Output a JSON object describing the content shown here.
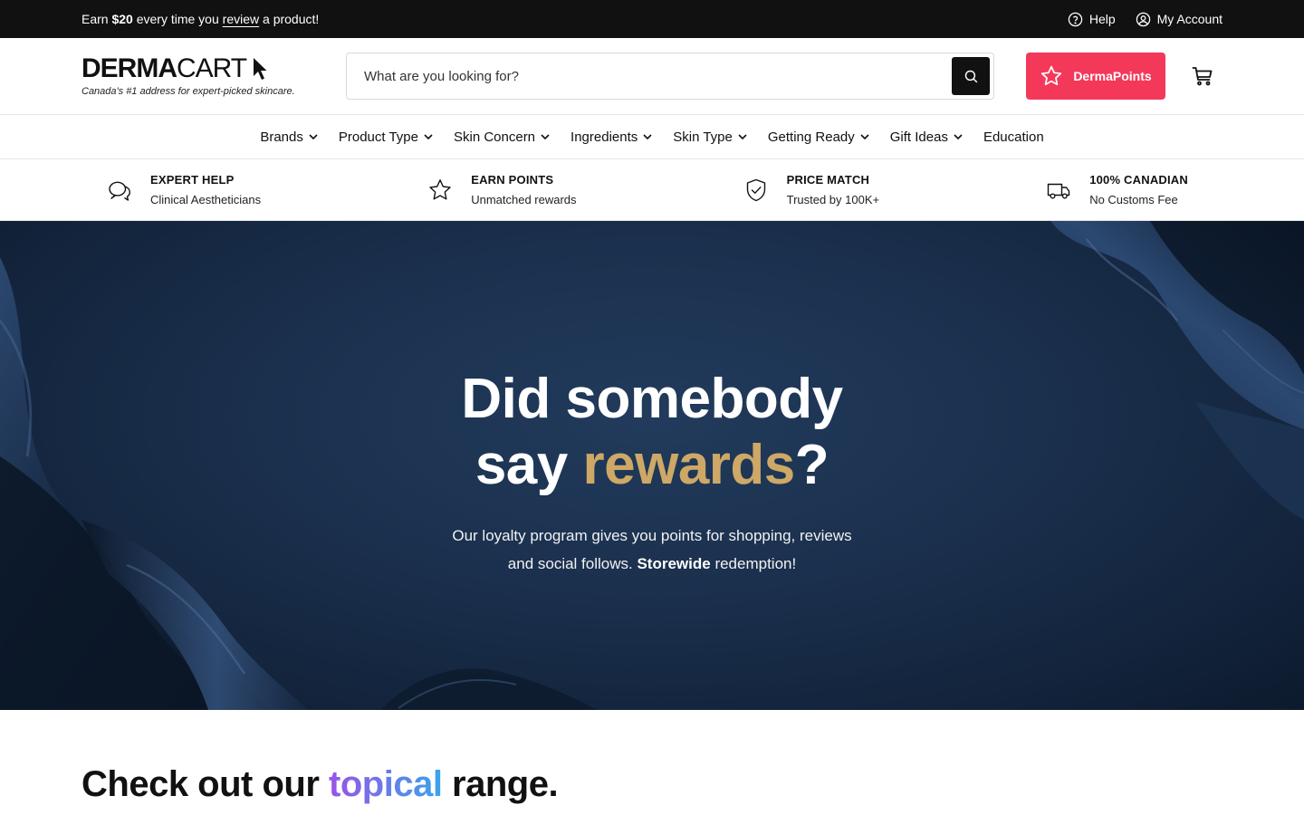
{
  "topbar": {
    "promo_pre": "Earn ",
    "promo_amount": "$20",
    "promo_mid": " every time you ",
    "promo_link": "review",
    "promo_post": " a product!",
    "help_label": "Help",
    "account_label": "My Account"
  },
  "header": {
    "logo_bold": "DERMA",
    "logo_light": "CART",
    "tagline": "Canada's #1 address for expert-picked skincare.",
    "search_placeholder": "What are you looking for?",
    "points_label": "DermaPoints"
  },
  "nav": {
    "items": [
      {
        "label": "Brands",
        "dropdown": true
      },
      {
        "label": "Product Type",
        "dropdown": true
      },
      {
        "label": "Skin Concern",
        "dropdown": true
      },
      {
        "label": "Ingredients",
        "dropdown": true
      },
      {
        "label": "Skin Type",
        "dropdown": true
      },
      {
        "label": "Getting Ready",
        "dropdown": true
      },
      {
        "label": "Gift Ideas",
        "dropdown": true
      },
      {
        "label": "Education",
        "dropdown": false
      }
    ]
  },
  "features": [
    {
      "icon": "chat-bubbles-icon",
      "title": "EXPERT HELP",
      "subtitle": "Clinical Aestheticians"
    },
    {
      "icon": "star-icon",
      "title": "EARN POINTS",
      "subtitle": "Unmatched rewards"
    },
    {
      "icon": "shield-check-icon",
      "title": "PRICE MATCH",
      "subtitle": "Trusted by 100K+"
    },
    {
      "icon": "truck-icon",
      "title": "100% CANADIAN",
      "subtitle": "No Customs Fee"
    }
  ],
  "hero": {
    "line1": "Did somebody",
    "line2_pre": "say ",
    "line2_highlight": "rewards",
    "line2_post": "?",
    "desc_line1": "Our loyalty program gives you points for shopping, reviews",
    "desc_line2_pre": "and social follows. ",
    "desc_bold": "Storewide",
    "desc_line2_post": " redemption!"
  },
  "section": {
    "title_pre": "Check out our ",
    "title_highlight": "topical",
    "title_post": " range."
  },
  "colors": {
    "accent_pink": "#f4385a",
    "gold": "#cda866",
    "hero_navy": "#1a2f4c",
    "gradient_start": "#9a53e6",
    "gradient_end": "#3aa3ec"
  }
}
